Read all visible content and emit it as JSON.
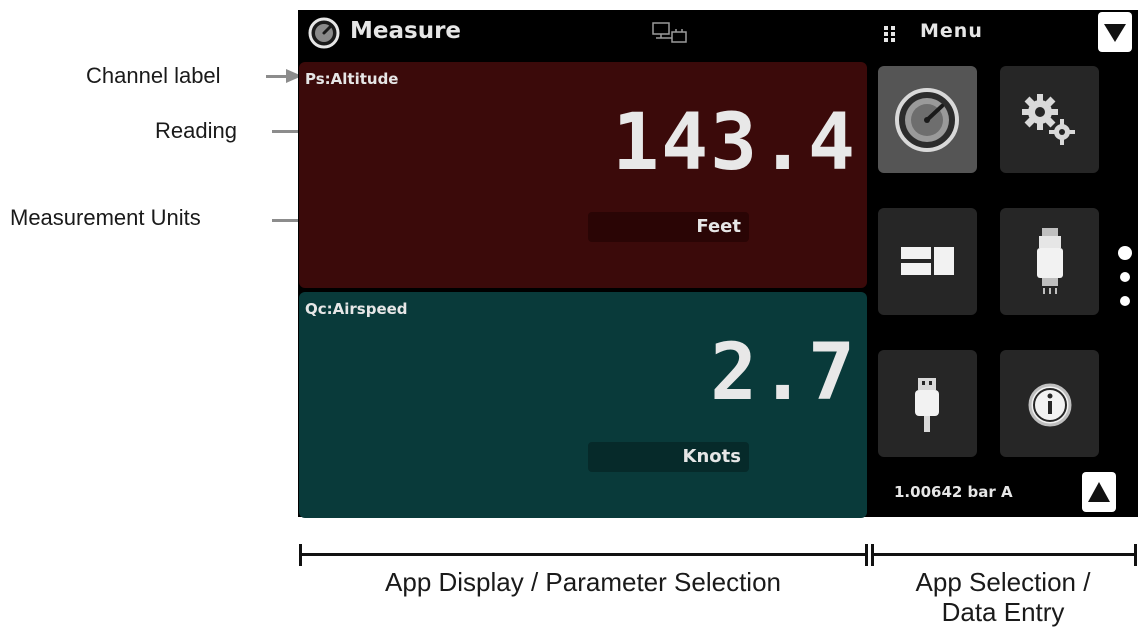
{
  "header": {
    "title": "Measure",
    "menu_label": "Menu"
  },
  "channels": [
    {
      "label": "Ps:Altitude",
      "reading": "143.4",
      "units": "Feet",
      "color": "#3b0a0a"
    },
    {
      "label": "Qc:Airspeed",
      "reading": "2.7",
      "units": "Knots",
      "color": "#093a3a"
    }
  ],
  "app_tiles": [
    {
      "name": "gauge-icon",
      "active": true
    },
    {
      "name": "gears-icon",
      "active": false
    },
    {
      "name": "display-layout-icon",
      "active": false
    },
    {
      "name": "pressure-sensor-icon",
      "active": false
    },
    {
      "name": "usb-icon",
      "active": false
    },
    {
      "name": "info-icon",
      "active": false
    }
  ],
  "status": {
    "barometric": "1.00642 bar A"
  },
  "callouts": {
    "channel_label": "Channel label",
    "reading": "Reading",
    "units": "Measurement Units"
  },
  "captions": {
    "left": "App Display / Parameter Selection",
    "right_line1": "App Selection /",
    "right_line2": "Data Entry"
  }
}
